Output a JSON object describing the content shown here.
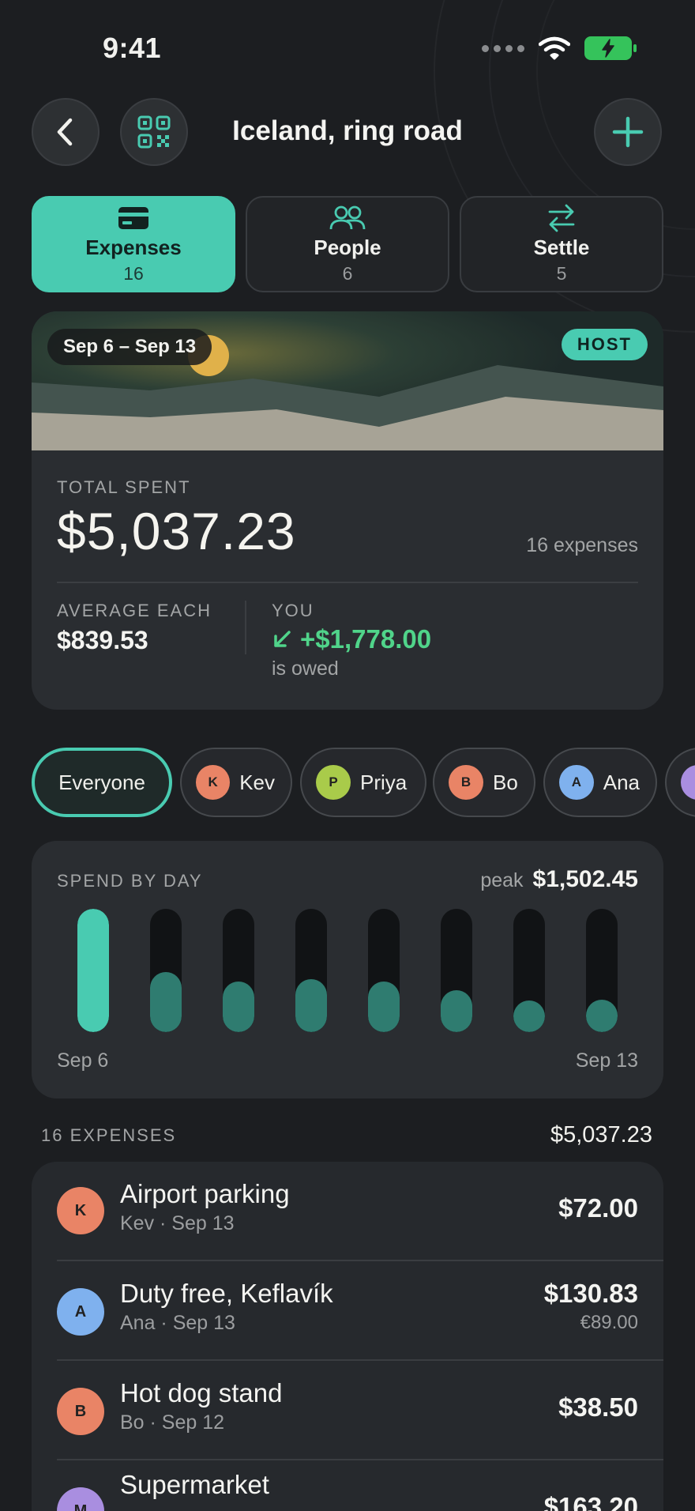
{
  "status_bar": {
    "time": "9:41"
  },
  "header": {
    "title": "Iceland, ring road"
  },
  "tabs": [
    {
      "label": "Expenses",
      "count": "16",
      "icon": "card-icon",
      "active": true
    },
    {
      "label": "People",
      "count": "6",
      "icon": "people-icon",
      "active": false
    },
    {
      "label": "Settle",
      "count": "5",
      "icon": "swap-arrows-icon",
      "active": false
    }
  ],
  "summary": {
    "date_range": "Sep 6 – Sep 13",
    "badge": "HOST",
    "total_label": "TOTAL SPENT",
    "total_amount": "$5,037.23",
    "expense_count": "16 expenses",
    "average_label": "AVERAGE EACH",
    "average_value": "$839.53",
    "you_label": "YOU",
    "you_value": "+$1,778.00",
    "you_sub": "is owed"
  },
  "filters": [
    {
      "label": "Everyone",
      "active": true
    },
    {
      "label": "Kev",
      "initial": "K",
      "color": "#e98466"
    },
    {
      "label": "Priya",
      "initial": "P",
      "color": "#a9cb4a"
    },
    {
      "label": "Bo",
      "initial": "B",
      "color": "#e98466"
    },
    {
      "label": "Ana",
      "initial": "A",
      "color": "#7fb1ee"
    },
    {
      "label": "",
      "initial": "",
      "color": "#a98ee0"
    }
  ],
  "spend": {
    "label": "SPEND BY DAY",
    "peak_word": "peak",
    "peak_value": "$1,502.45",
    "start": "Sep 6",
    "end": "Sep 13",
    "levels": [
      1.0,
      0.49,
      0.41,
      0.43,
      0.41,
      0.34,
      0.25,
      0.26
    ]
  },
  "list": {
    "heading": "16 EXPENSES",
    "total": "$5,037.23",
    "items": [
      {
        "title": "Airport parking",
        "sub": "Kev · Sep 13",
        "amount": "$72.00",
        "original": "",
        "initial": "K",
        "color": "#e98466"
      },
      {
        "title": "Duty free, Keflavík",
        "sub": "Ana · Sep 13",
        "amount": "$130.83",
        "original": "€89.00",
        "initial": "A",
        "color": "#7fb1ee"
      },
      {
        "title": "Hot dog stand",
        "sub": "Bo · Sep 12",
        "amount": "$38.50",
        "original": "",
        "initial": "B",
        "color": "#e98466"
      },
      {
        "title": "Supermarket",
        "sub": "",
        "amount": "$163.20",
        "original": "",
        "initial": "M",
        "color": "#a98ee0"
      }
    ]
  },
  "colors": {
    "accent": "#49cbb1",
    "positive": "#50d48a",
    "background": "#1c1e21",
    "card": "#2a2d31"
  }
}
